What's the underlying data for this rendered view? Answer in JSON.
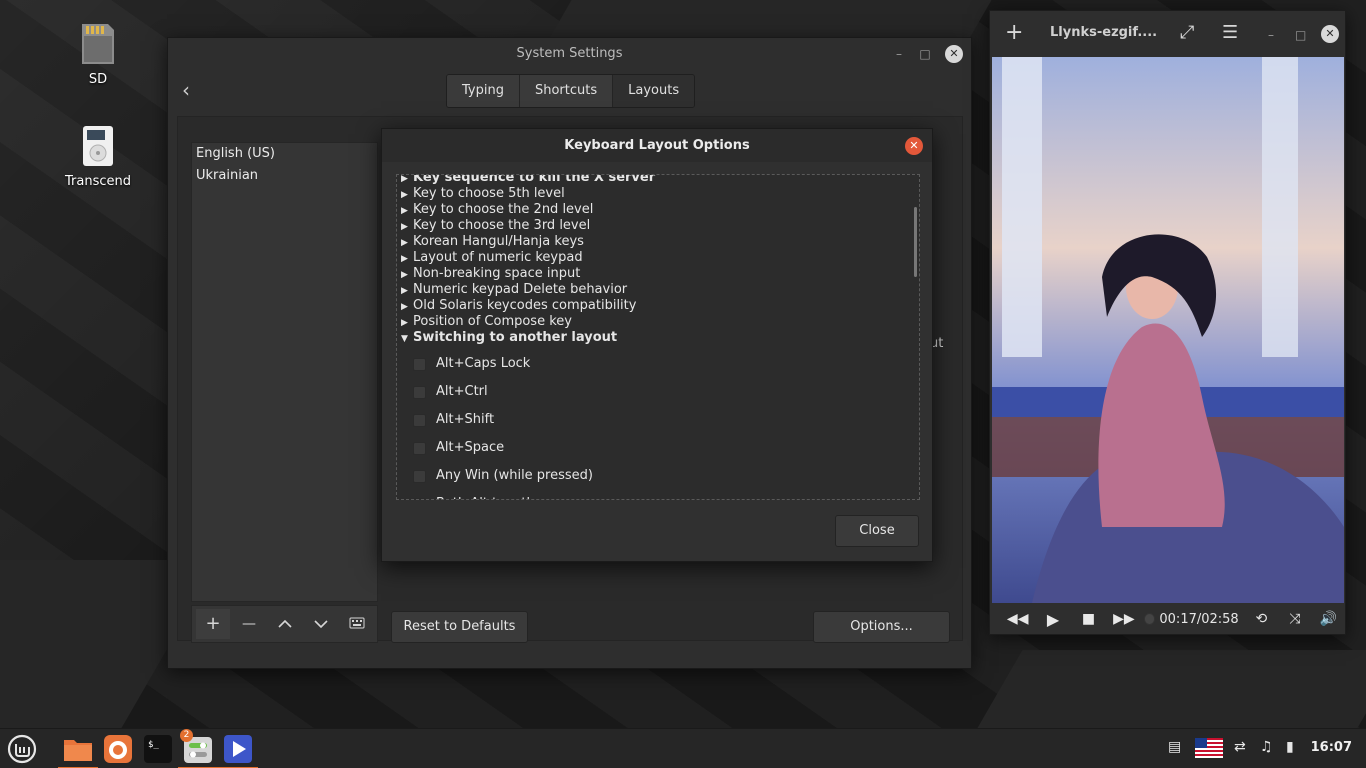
{
  "desktop": {
    "icons": [
      {
        "label": "SD",
        "icon": "sd-card-icon"
      },
      {
        "label": "Transcend",
        "icon": "drive-icon"
      }
    ]
  },
  "settings": {
    "title": "System Settings",
    "tabs": [
      {
        "label": "Typing"
      },
      {
        "label": "Shortcuts"
      },
      {
        "label": "Layouts"
      }
    ],
    "active_tab": "Layouts",
    "layouts": [
      "English (US)",
      "Ukrainian"
    ],
    "toolbar": {
      "add": "+",
      "remove": "—",
      "up": "^",
      "down": "v"
    },
    "reset_label": "Reset to Defaults",
    "options_label": "Options...",
    "cutoff_text": "ut"
  },
  "dialog": {
    "title": "Keyboard Layout Options",
    "tree_items": [
      {
        "label": "Key sequence to kill the X server",
        "bold": true,
        "expanded": false
      },
      {
        "label": "Key to choose 5th level",
        "bold": false,
        "expanded": false
      },
      {
        "label": "Key to choose the 2nd level",
        "bold": false,
        "expanded": false
      },
      {
        "label": "Key to choose the 3rd level",
        "bold": false,
        "expanded": false
      },
      {
        "label": "Korean Hangul/Hanja keys",
        "bold": false,
        "expanded": false
      },
      {
        "label": "Layout of numeric keypad",
        "bold": false,
        "expanded": false
      },
      {
        "label": "Non-breaking space input",
        "bold": false,
        "expanded": false
      },
      {
        "label": "Numeric keypad Delete behavior",
        "bold": false,
        "expanded": false
      },
      {
        "label": "Old Solaris keycodes compatibility",
        "bold": false,
        "expanded": false
      },
      {
        "label": "Position of Compose key",
        "bold": false,
        "expanded": false
      },
      {
        "label": "Switching to another layout",
        "bold": true,
        "expanded": true
      }
    ],
    "options": [
      {
        "label": "Alt+Caps Lock",
        "checked": false
      },
      {
        "label": "Alt+Ctrl",
        "checked": false
      },
      {
        "label": "Alt+Shift",
        "checked": false
      },
      {
        "label": "Alt+Space",
        "checked": false
      },
      {
        "label": "Any Win (while pressed)",
        "checked": false
      },
      {
        "label": "Both Alt together",
        "checked": false
      }
    ],
    "close_label": "Close"
  },
  "player": {
    "title": "Llynks-ezgif....",
    "time": "00:17/02:58"
  },
  "taskbar": {
    "badge": "2",
    "clock": "16:07"
  },
  "colors": {
    "accent": "#e3583a",
    "taskbar_active": "#e3702f"
  }
}
